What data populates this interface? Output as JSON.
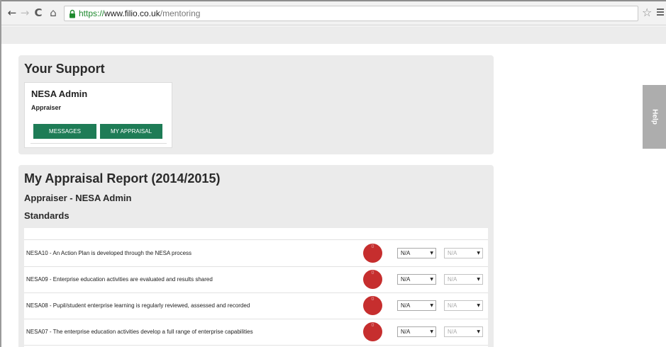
{
  "browser": {
    "url_protocol": "https://",
    "url_host": "www.filio.co.uk",
    "url_path": "/mentoring",
    "back_glyph": "←",
    "forward_glyph": "→",
    "reload_glyph": "C",
    "home_glyph": "⌂",
    "star_glyph": "☆"
  },
  "support": {
    "title": "Your Support",
    "card_name": "NESA Admin",
    "card_role": "Appraiser",
    "messages_label": "MESSAGES",
    "my_appraisal_label": "MY APPRAISAL"
  },
  "appraisal": {
    "title": "My Appraisal Report (2014/2015)",
    "appraiser_line": "Appraiser - NESA Admin",
    "standards_heading": "Standards",
    "rows": [
      {
        "text": "NESA10 - An Action Plan is developed through the NESA process",
        "score": "0",
        "select_a": "N/A",
        "select_b": "N/A"
      },
      {
        "text": "NESA09 - Enterprise education activities are evaluated and results shared",
        "score": "0",
        "select_a": "N/A",
        "select_b": "N/A"
      },
      {
        "text": "NESA08 - Pupil/student enterprise learning is regularly reviewed, assessed and recorded",
        "score": "0",
        "select_a": "N/A",
        "select_b": "N/A"
      },
      {
        "text": "NESA07 - The enterprise education activities develop a full range of enterprise capabilities",
        "score": "0",
        "select_a": "N/A",
        "select_b": "N/A"
      }
    ]
  },
  "help": {
    "label": "Help"
  },
  "colors": {
    "button_green": "#1e7c56",
    "score_red": "#c62e2e",
    "panel_grey": "#ebebeb",
    "help_grey": "#adadad"
  }
}
